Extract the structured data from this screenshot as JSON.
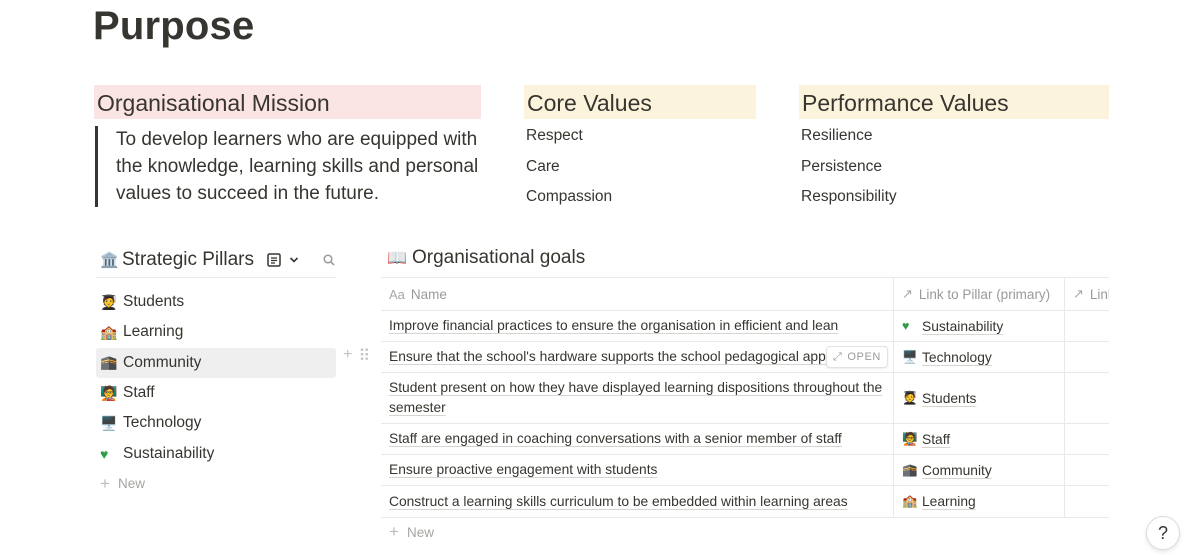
{
  "page": {
    "title": "Purpose"
  },
  "mission": {
    "heading": "Organisational Mission",
    "text": "To develop learners who are equipped with the knowledge, learning skills and personal values to succeed in the future.",
    "heading_color": "#fbe4e4"
  },
  "core_values": {
    "heading": "Core Values",
    "items": [
      "Respect",
      "Care",
      "Compassion"
    ],
    "heading_color": "#fbf3db"
  },
  "performance_values": {
    "heading": "Performance Values",
    "items": [
      "Resilience",
      "Persistence",
      "Responsibility"
    ],
    "heading_color": "#fbf3db"
  },
  "pillars": {
    "title": "Strategic Pillars",
    "title_icon": "classical-building-icon",
    "items": [
      {
        "name": "Students",
        "icon": "student-icon"
      },
      {
        "name": "Learning",
        "icon": "school-icon"
      },
      {
        "name": "Community",
        "icon": "kaaba-icon"
      },
      {
        "name": "Staff",
        "icon": "teacher-icon"
      },
      {
        "name": "Technology",
        "icon": "desktop-computer-icon"
      },
      {
        "name": "Sustainability",
        "icon": "green-heart-icon"
      }
    ],
    "new_label": "New"
  },
  "goals": {
    "title": "Organisational goals",
    "title_icon": "open-book-icon",
    "columns": [
      "Name",
      "Link to Pillar (primary)",
      "Link"
    ],
    "rows": [
      {
        "name": "Improve financial practices to ensure the organisation in efficient and lean",
        "pillar": "Sustainability"
      },
      {
        "name": "Ensure that the school's hardware supports the school pedagogical appro",
        "pillar": "Technology"
      },
      {
        "name": "Student present on how they have displayed learning dispositions throughout the semester",
        "pillar": "Students"
      },
      {
        "name": "Staff are engaged in coaching conversations with a senior member of staff",
        "pillar": "Staff"
      },
      {
        "name": "Ensure proactive engagement with students",
        "pillar": "Community"
      },
      {
        "name": "Construct a learning skills curriculum to be embedded within learning areas",
        "pillar": "Learning"
      }
    ],
    "open_label": "OPEN",
    "new_label": "New"
  },
  "help": {
    "label": "?"
  }
}
